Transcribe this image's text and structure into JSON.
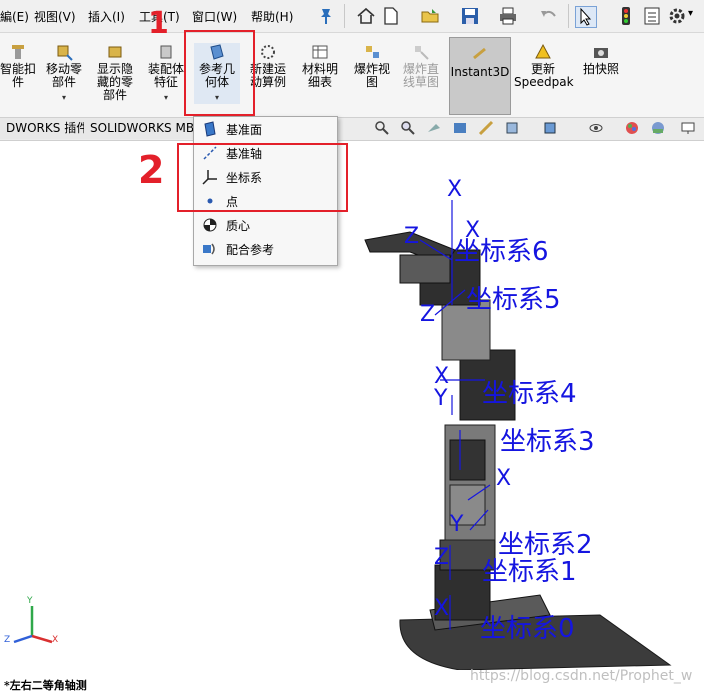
{
  "menubar": {
    "items": [
      "編(E)",
      "视图(V)",
      "插入(I)",
      "工具(T)",
      "窗口(W)",
      "帮助(H)"
    ]
  },
  "ribbon": {
    "buttons": [
      {
        "label": "智能扣\n件"
      },
      {
        "label": "移动零\n部件"
      },
      {
        "label": "显示隐\n藏的零\n部件"
      },
      {
        "label": "装配体\n特征"
      },
      {
        "label": "参考几\n何体"
      },
      {
        "label": "新建运\n动算例"
      },
      {
        "label": "材料明\n细表"
      },
      {
        "label": "爆炸视\n图"
      },
      {
        "label": "爆炸直\n线草图"
      },
      {
        "label": "Instant3D"
      },
      {
        "label": "更新\nSpeedpak"
      },
      {
        "label": "拍快照"
      }
    ]
  },
  "tabs": [
    "DWORKS 插件",
    "SOLIDWORKS MBD"
  ],
  "dropdown": {
    "items": [
      "基准面",
      "基准轴",
      "坐标系",
      "点",
      "质心",
      "配合参考"
    ]
  },
  "annotations": {
    "step1": "1",
    "step2": "2"
  },
  "model": {
    "coords": [
      "坐标系6",
      "坐标系5",
      "坐标系4",
      "坐标系3",
      "坐标系2",
      "坐标系1",
      "坐标系0"
    ],
    "axis_x": "X",
    "axis_y": "Y",
    "axis_z": "Z"
  },
  "triad": {
    "y": "Y",
    "z": "Z",
    "x": "X"
  },
  "view_name": "*左右二等角轴测",
  "watermark": "https://blog.csdn.net/Prophet_w",
  "colors": {
    "annotation": "#e3202a",
    "coord_label": "#1515e0"
  }
}
